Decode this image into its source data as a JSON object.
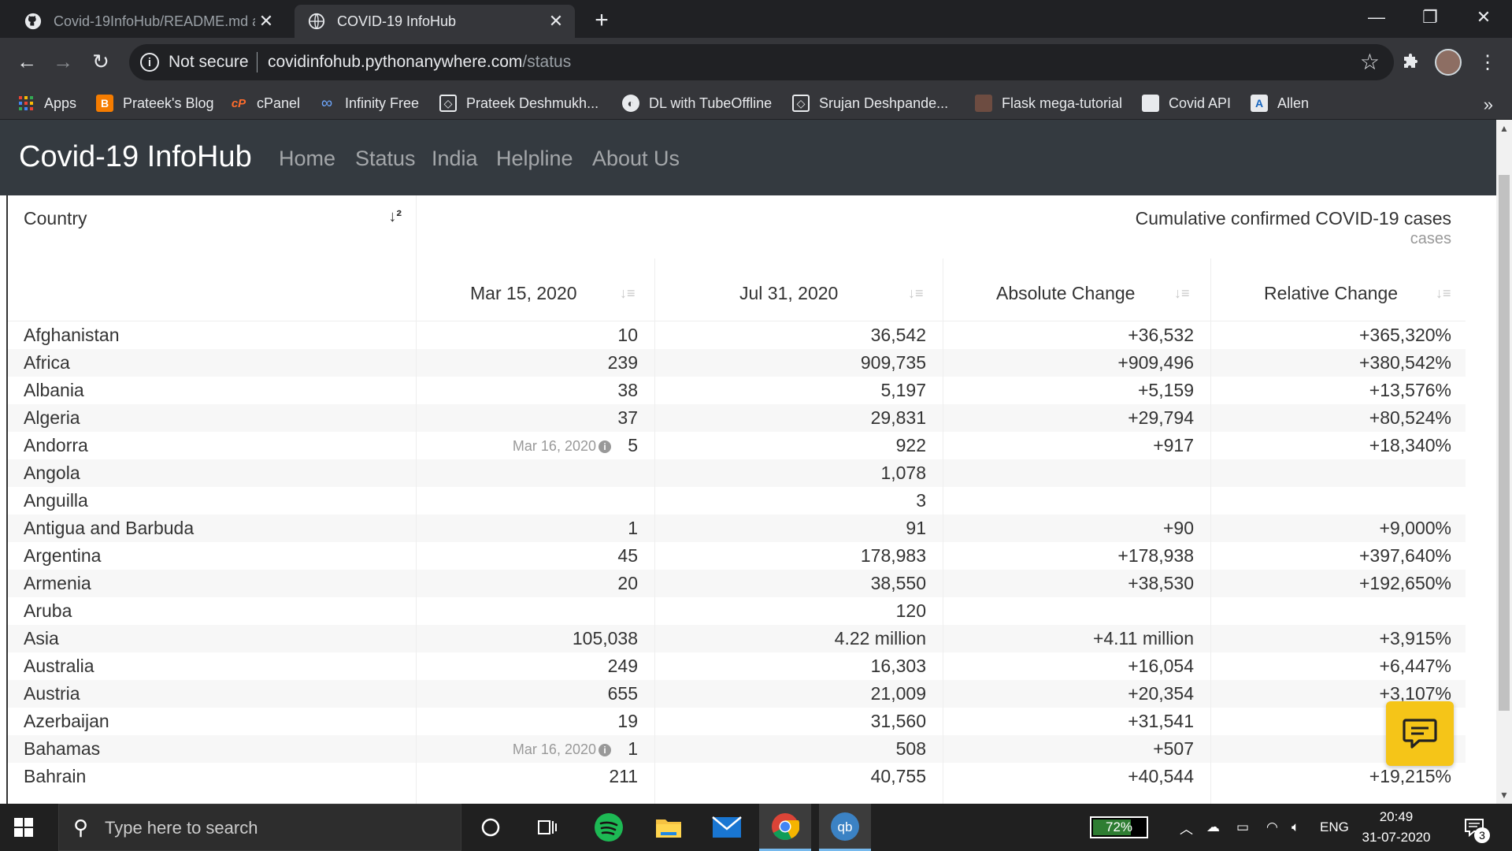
{
  "browser": {
    "tabs": [
      {
        "title": "Covid-19InfoHub/README.md at",
        "active": false
      },
      {
        "title": "COVID-19 InfoHub",
        "active": true
      }
    ],
    "security_label": "Not secure",
    "url_domain": "covidinfohub.pythonanywhere.com",
    "url_path": "/status",
    "bookmarks": [
      {
        "label": "Apps",
        "icon": "apps-grid-icon"
      },
      {
        "label": "Prateek's Blog",
        "icon": "blogger-icon"
      },
      {
        "label": "cPanel",
        "icon": "cpanel-icon"
      },
      {
        "label": "Infinity Free",
        "icon": "infinity-icon"
      },
      {
        "label": "Prateek Deshmukh...",
        "icon": "codepen-icon"
      },
      {
        "label": "DL with TubeOffline",
        "icon": "globe-icon"
      },
      {
        "label": "Srujan Deshpande...",
        "icon": "codepen-icon"
      },
      {
        "label": "Flask mega-tutorial",
        "icon": "profile-photo-icon"
      },
      {
        "label": "Covid API",
        "icon": "cube-icon"
      },
      {
        "label": "Allen",
        "icon": "allen-icon"
      }
    ],
    "more_bookmarks": "»"
  },
  "site": {
    "brand": "Covid-19 InfoHub",
    "nav": [
      "Home",
      "Status",
      "India",
      "Helpline",
      "About Us"
    ]
  },
  "table": {
    "country_header": "Country",
    "chart_title": "Cumulative confirmed COVID-19 cases",
    "chart_subtitle": "cases",
    "columns": [
      "Mar 15, 2020",
      "Jul 31, 2020",
      "Absolute Change",
      "Relative Change"
    ],
    "rows": [
      {
        "country": "Afghanistan",
        "note": "",
        "mar15": "10",
        "jul31": "36,542",
        "abs": "+36,532",
        "rel": "+365,320%"
      },
      {
        "country": "Africa",
        "note": "",
        "mar15": "239",
        "jul31": "909,735",
        "abs": "+909,496",
        "rel": "+380,542%"
      },
      {
        "country": "Albania",
        "note": "",
        "mar15": "38",
        "jul31": "5,197",
        "abs": "+5,159",
        "rel": "+13,576%"
      },
      {
        "country": "Algeria",
        "note": "",
        "mar15": "37",
        "jul31": "29,831",
        "abs": "+29,794",
        "rel": "+80,524%"
      },
      {
        "country": "Andorra",
        "note": "Mar 16, 2020",
        "mar15": "5",
        "jul31": "922",
        "abs": "+917",
        "rel": "+18,340%"
      },
      {
        "country": "Angola",
        "note": "",
        "mar15": "",
        "jul31": "1,078",
        "abs": "",
        "rel": ""
      },
      {
        "country": "Anguilla",
        "note": "",
        "mar15": "",
        "jul31": "3",
        "abs": "",
        "rel": ""
      },
      {
        "country": "Antigua and Barbuda",
        "note": "",
        "mar15": "1",
        "jul31": "91",
        "abs": "+90",
        "rel": "+9,000%"
      },
      {
        "country": "Argentina",
        "note": "",
        "mar15": "45",
        "jul31": "178,983",
        "abs": "+178,938",
        "rel": "+397,640%"
      },
      {
        "country": "Armenia",
        "note": "",
        "mar15": "20",
        "jul31": "38,550",
        "abs": "+38,530",
        "rel": "+192,650%"
      },
      {
        "country": "Aruba",
        "note": "",
        "mar15": "",
        "jul31": "120",
        "abs": "",
        "rel": ""
      },
      {
        "country": "Asia",
        "note": "",
        "mar15": "105,038",
        "jul31": "4.22 million",
        "abs": "+4.11 million",
        "rel": "+3,915%"
      },
      {
        "country": "Australia",
        "note": "",
        "mar15": "249",
        "jul31": "16,303",
        "abs": "+16,054",
        "rel": "+6,447%"
      },
      {
        "country": "Austria",
        "note": "",
        "mar15": "655",
        "jul31": "21,009",
        "abs": "+20,354",
        "rel": "+3,107%"
      },
      {
        "country": "Azerbaijan",
        "note": "",
        "mar15": "19",
        "jul31": "31,560",
        "abs": "+31,541",
        "rel": "+16"
      },
      {
        "country": "Bahamas",
        "note": "Mar 16, 2020",
        "mar15": "1",
        "jul31": "508",
        "abs": "+507",
        "rel": "+5"
      },
      {
        "country": "Bahrain",
        "note": "",
        "mar15": "211",
        "jul31": "40,755",
        "abs": "+40,544",
        "rel": "+19,215%"
      }
    ]
  },
  "taskbar": {
    "search_placeholder": "Type here to search",
    "battery_percent": 72,
    "battery_label": "72%",
    "language": "ENG",
    "time": "20:49",
    "date": "31-07-2020",
    "notifications": "3"
  },
  "colors": {
    "navbar": "#343a40",
    "feedback": "#f5c518",
    "chrome_dark": "#202124",
    "chrome_mid": "#35363a"
  }
}
